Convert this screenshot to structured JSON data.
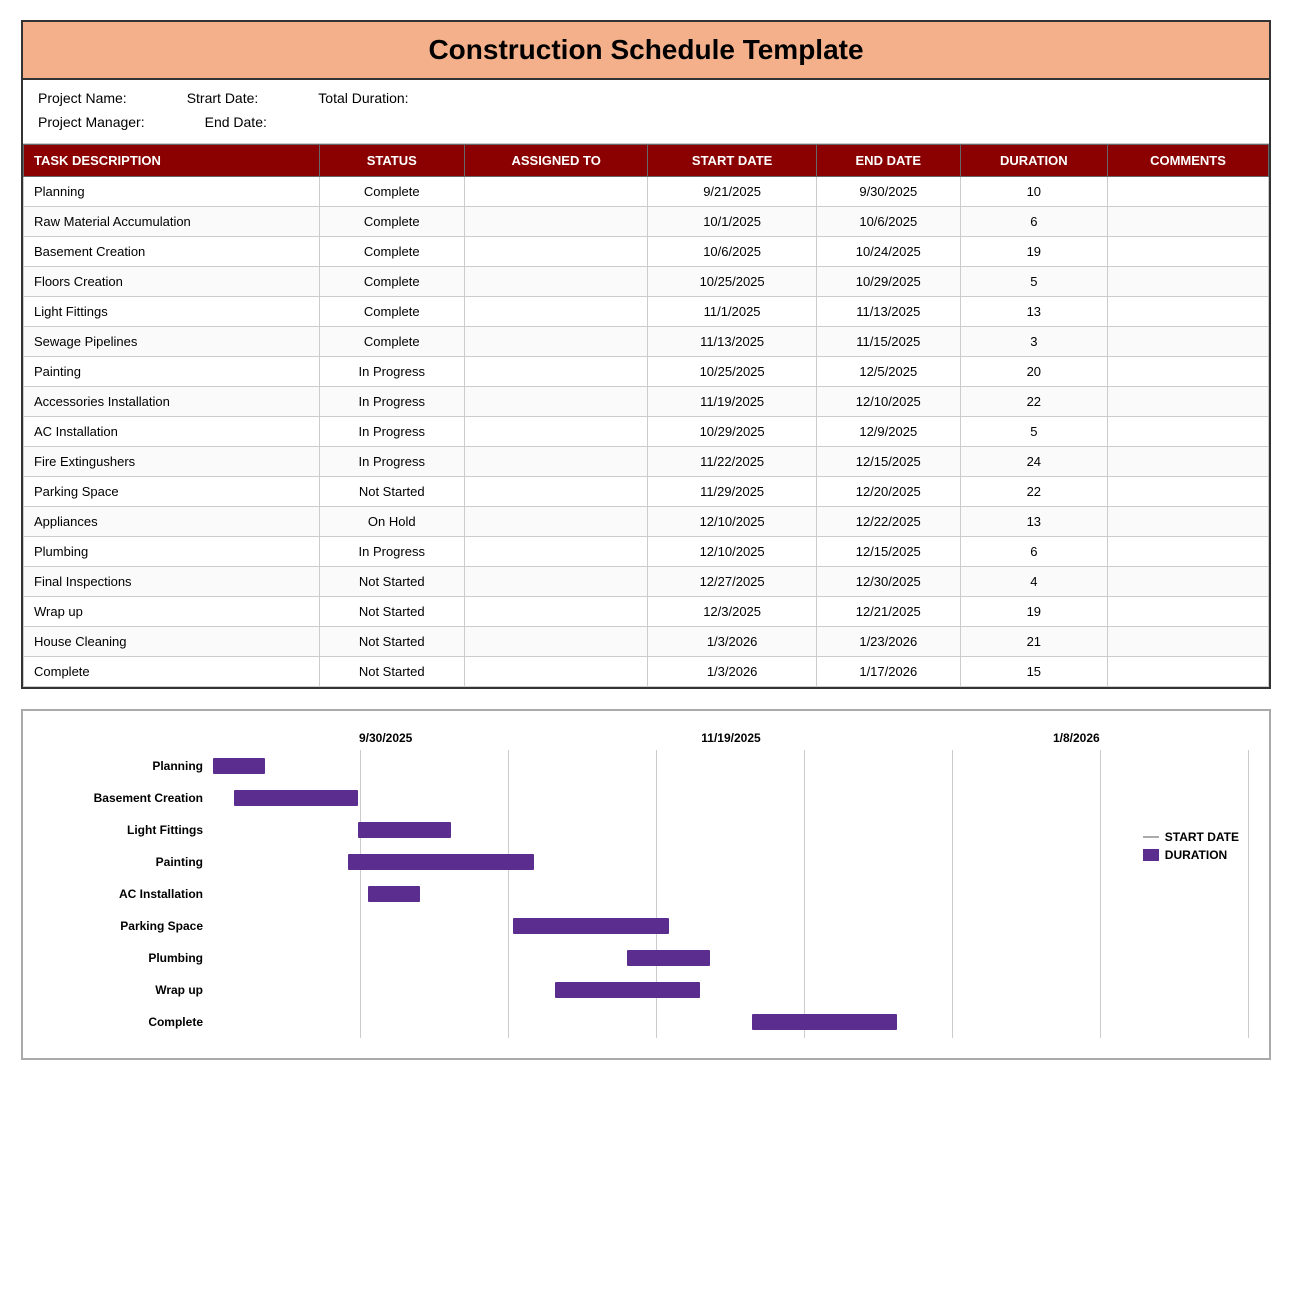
{
  "title": "Construction Schedule Template",
  "meta": {
    "project_name_label": "Project Name:",
    "start_date_label": "Strart Date:",
    "total_duration_label": "Total Duration:",
    "project_manager_label": "Project Manager:",
    "end_date_label": "End Date:"
  },
  "table": {
    "headers": [
      "TASK DESCRIPTION",
      "STATUS",
      "ASSIGNED TO",
      "START DATE",
      "END DATE",
      "DURATION",
      "COMMENTS"
    ],
    "rows": [
      {
        "task": "Planning",
        "status": "Complete",
        "assigned": "",
        "start": "9/21/2025",
        "end": "9/30/2025",
        "duration": "10",
        "comments": ""
      },
      {
        "task": "Raw Material Accumulation",
        "status": "Complete",
        "assigned": "",
        "start": "10/1/2025",
        "end": "10/6/2025",
        "duration": "6",
        "comments": ""
      },
      {
        "task": "Basement Creation",
        "status": "Complete",
        "assigned": "",
        "start": "10/6/2025",
        "end": "10/24/2025",
        "duration": "19",
        "comments": ""
      },
      {
        "task": "Floors Creation",
        "status": "Complete",
        "assigned": "",
        "start": "10/25/2025",
        "end": "10/29/2025",
        "duration": "5",
        "comments": ""
      },
      {
        "task": "Light Fittings",
        "status": "Complete",
        "assigned": "",
        "start": "11/1/2025",
        "end": "11/13/2025",
        "duration": "13",
        "comments": ""
      },
      {
        "task": "Sewage Pipelines",
        "status": "Complete",
        "assigned": "",
        "start": "11/13/2025",
        "end": "11/15/2025",
        "duration": "3",
        "comments": ""
      },
      {
        "task": "Painting",
        "status": "In Progress",
        "assigned": "",
        "start": "10/25/2025",
        "end": "12/5/2025",
        "duration": "20",
        "comments": ""
      },
      {
        "task": "Accessories Installation",
        "status": "In Progress",
        "assigned": "",
        "start": "11/19/2025",
        "end": "12/10/2025",
        "duration": "22",
        "comments": ""
      },
      {
        "task": "AC Installation",
        "status": "In Progress",
        "assigned": "",
        "start": "10/29/2025",
        "end": "12/9/2025",
        "duration": "5",
        "comments": ""
      },
      {
        "task": "Fire Extingushers",
        "status": "In Progress",
        "assigned": "",
        "start": "11/22/2025",
        "end": "12/15/2025",
        "duration": "24",
        "comments": ""
      },
      {
        "task": "Parking Space",
        "status": "Not Started",
        "assigned": "",
        "start": "11/29/2025",
        "end": "12/20/2025",
        "duration": "22",
        "comments": ""
      },
      {
        "task": "Appliances",
        "status": "On Hold",
        "assigned": "",
        "start": "12/10/2025",
        "end": "12/22/2025",
        "duration": "13",
        "comments": ""
      },
      {
        "task": "Plumbing",
        "status": "In Progress",
        "assigned": "",
        "start": "12/10/2025",
        "end": "12/15/2025",
        "duration": "6",
        "comments": ""
      },
      {
        "task": "Final Inspections",
        "status": "Not Started",
        "assigned": "",
        "start": "12/27/2025",
        "end": "12/30/2025",
        "duration": "4",
        "comments": ""
      },
      {
        "task": "Wrap up",
        "status": "Not Started",
        "assigned": "",
        "start": "12/3/2025",
        "end": "12/21/2025",
        "duration": "19",
        "comments": ""
      },
      {
        "task": "House Cleaning",
        "status": "Not Started",
        "assigned": "",
        "start": "1/3/2026",
        "end": "1/23/2026",
        "duration": "21",
        "comments": ""
      },
      {
        "task": "Complete",
        "status": "Not Started",
        "assigned": "",
        "start": "1/3/2026",
        "end": "1/17/2026",
        "duration": "15",
        "comments": ""
      }
    ]
  },
  "gantt": {
    "date_labels": [
      "9/30/2025",
      "11/19/2025",
      "1/8/2026"
    ],
    "legend": {
      "start_date_label": "START DATE",
      "duration_label": "DURATION"
    },
    "tasks": [
      {
        "name": "Planning",
        "start_pct": 0,
        "width_pct": 5
      },
      {
        "name": "Basement Creation",
        "start_pct": 2,
        "width_pct": 12
      },
      {
        "name": "Light Fittings",
        "start_pct": 14,
        "width_pct": 9
      },
      {
        "name": "Painting",
        "start_pct": 13,
        "width_pct": 18
      },
      {
        "name": "AC Installation",
        "start_pct": 15,
        "width_pct": 5
      },
      {
        "name": "Parking Space",
        "start_pct": 29,
        "width_pct": 15
      },
      {
        "name": "Plumbing",
        "start_pct": 40,
        "width_pct": 8
      },
      {
        "name": "Wrap up",
        "start_pct": 33,
        "width_pct": 14
      },
      {
        "name": "Complete",
        "start_pct": 52,
        "width_pct": 14
      }
    ]
  }
}
